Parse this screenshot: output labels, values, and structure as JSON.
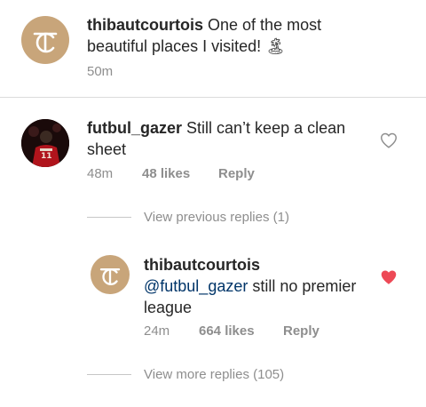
{
  "comments": [
    {
      "username": "thibautcourtois",
      "text": "One of the most beautiful places I visited! 🏝",
      "time": "50m",
      "avatar": "tc-monogram-avatar"
    },
    {
      "username": "futbul_gazer",
      "text": "Still can’t keep a clean sheet",
      "time": "48m",
      "likes": "48 likes",
      "reply_label": "Reply",
      "avatar": "player-photo-avatar",
      "liked": false
    }
  ],
  "view_previous_replies": "View previous replies (1)",
  "reply": {
    "username": "thibautcourtois",
    "mention": "@futbul_gazer",
    "text": "still no premier league",
    "time": "24m",
    "likes": "664 likes",
    "reply_label": "Reply",
    "liked": true
  },
  "view_more_replies": "View more replies (105)",
  "colors": {
    "avatar_gold": "#c8a57a",
    "heart_red": "#ed4956",
    "mention_blue": "#003569",
    "meta_gray": "#8e8e8e"
  }
}
